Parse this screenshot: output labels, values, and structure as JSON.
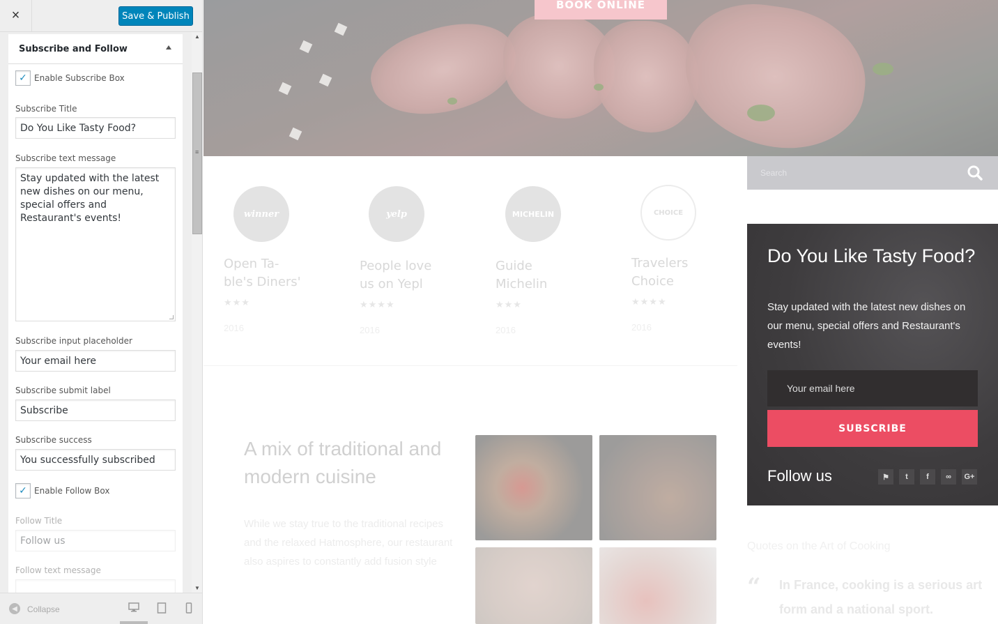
{
  "customizer": {
    "close_icon": "×",
    "publish_label": "Save & Publish",
    "section_title": "Subscribe and Follow",
    "enable_subscribe_label": "Enable Subscribe Box",
    "enable_subscribe_checked": true,
    "subscribe_title_label": "Subscribe Title",
    "subscribe_title_value": "Do You Like Tasty Food?",
    "subscribe_text_label": "Subscribe text message",
    "subscribe_text_value": "Stay updated with the latest new dishes on our menu, special offers and Restaurant's events!",
    "placeholder_label": "Subscribe input placeholder",
    "placeholder_value": "Your email here",
    "submit_label_label": "Subscribe submit label",
    "submit_label_value": "Subscribe",
    "success_label": "Subscribe success",
    "success_value": "You successfully subscribed",
    "enable_follow_label": "Enable Follow Box",
    "enable_follow_checked": true,
    "follow_title_label": "Follow Title",
    "follow_title_value": "Follow us",
    "follow_text_label": "Follow text message",
    "collapse_label": "Collapse",
    "devices": [
      "desktop-icon",
      "tablet-icon",
      "mobile-icon"
    ]
  },
  "preview": {
    "book_online": "BOOK ONLINE",
    "awards": [
      {
        "badge": "winner",
        "title": "Open Ta-\nble's Diners'",
        "stars": "★★★",
        "year": "2016"
      },
      {
        "badge": "yelp",
        "title": "People love us on Yepl",
        "stars": "★★★★",
        "year": "2016"
      },
      {
        "badge": "MICHELIN",
        "title": "Guide Michelin",
        "stars": "★★★",
        "year": "2016"
      },
      {
        "badge": "CHOICE",
        "title": "Travelers Choice",
        "stars": "★★★★",
        "year": "2016"
      }
    ],
    "mix_title": "A mix of traditional and modern cuisine",
    "mix_text": "While we stay true to the traditional recipes and the relaxed  Hatmosphere, our restaurant also aspires to constantly add fusion style",
    "search_placeholder": "Search",
    "subscribe": {
      "title": "Do You Like Tasty Food?",
      "text": "Stay updated with the latest new dishes on our menu, special offers and Restaurant's events!",
      "email_placeholder": "Your email here",
      "button": "SUBSCRIBE",
      "follow_title": "Follow us",
      "social_icons": [
        "foursquare-icon",
        "twitter-icon",
        "facebook-icon",
        "tripadvisor-icon",
        "google-plus-icon"
      ]
    },
    "quotes_heading": "Quotes on the Art of Cooking",
    "quote_text": "In France, cooking is a serious art form and a national sport."
  },
  "colors": {
    "publish_blue": "#0085ba",
    "subscribe_button": "#ec4d63",
    "subscribe_box": "#3e3c3e"
  }
}
